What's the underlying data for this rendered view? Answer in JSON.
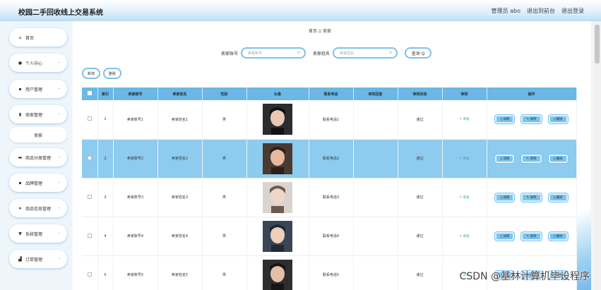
{
  "app": {
    "title": "校园二手回收线上交易系统"
  },
  "topbar": {
    "admin": "管理员 abo",
    "back_front": "退出到前台",
    "logout": "退出登录"
  },
  "sidebar": {
    "items": [
      {
        "label": "首页",
        "icon": "home-icon",
        "has_chevron": false
      },
      {
        "label": "个人中心",
        "icon": "user-icon",
        "has_chevron": true
      },
      {
        "label": "用户管理",
        "icon": "grid-icon",
        "has_chevron": true
      },
      {
        "label": "卖家管理",
        "icon": "doc-icon",
        "has_chevron": true
      },
      {
        "label": "商品分类管理",
        "icon": "box-icon",
        "has_chevron": true
      },
      {
        "label": "品牌管理",
        "icon": "grid-icon",
        "has_chevron": true
      },
      {
        "label": "商品信息管理",
        "icon": "send-icon",
        "has_chevron": true
      },
      {
        "label": "系统管理",
        "icon": "pin-icon",
        "has_chevron": true
      },
      {
        "label": "订单管理",
        "icon": "chart-icon",
        "has_chevron": true
      }
    ],
    "sub_item": "卖家"
  },
  "breadcrumb": {
    "home": "首页",
    "sep": "//",
    "current": "卖家"
  },
  "search": {
    "account_label": "卖家账号",
    "account_placeholder": "卖家账号",
    "name_label": "卖家姓名",
    "name_placeholder": "卖家姓名",
    "query": "查询 Q"
  },
  "actions": {
    "add": "新增",
    "delete": "删除"
  },
  "table": {
    "headers": [
      "",
      "索引",
      "卖家账号",
      "卖家姓名",
      "性别",
      "头像",
      "联系电话",
      "审核回复",
      "审核状态",
      "审核",
      "操作"
    ],
    "audit_label": "✎ 审核",
    "op_detail": "▯ 详情",
    "op_edit": "✎ 修改",
    "op_delete": "▯ 删除",
    "rows": [
      {
        "index": "1",
        "account": "卖家账号1",
        "name": "卖家姓名1",
        "gender": "男",
        "phone": "联系电话1",
        "reply": "",
        "status": "通过",
        "highlight": false
      },
      {
        "index": "2",
        "account": "卖家账号2",
        "name": "卖家姓名2",
        "gender": "男",
        "phone": "联系电话2",
        "reply": "",
        "status": "通过",
        "highlight": true
      },
      {
        "index": "3",
        "account": "卖家账号3",
        "name": "卖家姓名3",
        "gender": "男",
        "phone": "联系电话3",
        "reply": "",
        "status": "通过",
        "highlight": false
      },
      {
        "index": "4",
        "account": "卖家账号4",
        "name": "卖家姓名4",
        "gender": "男",
        "phone": "联系电话4",
        "reply": "",
        "status": "通过",
        "highlight": false
      },
      {
        "index": "5",
        "account": "卖家账号5",
        "name": "卖家姓名5",
        "gender": "男",
        "phone": "联系电话5",
        "reply": "",
        "status": "通过",
        "highlight": false
      }
    ]
  },
  "watermark": "CSDN @基林计算机毕设程序",
  "colors": {
    "accent": "#6cb7e6",
    "highlight_row": "#8dcbef",
    "button_border": "#7fc1ea"
  }
}
